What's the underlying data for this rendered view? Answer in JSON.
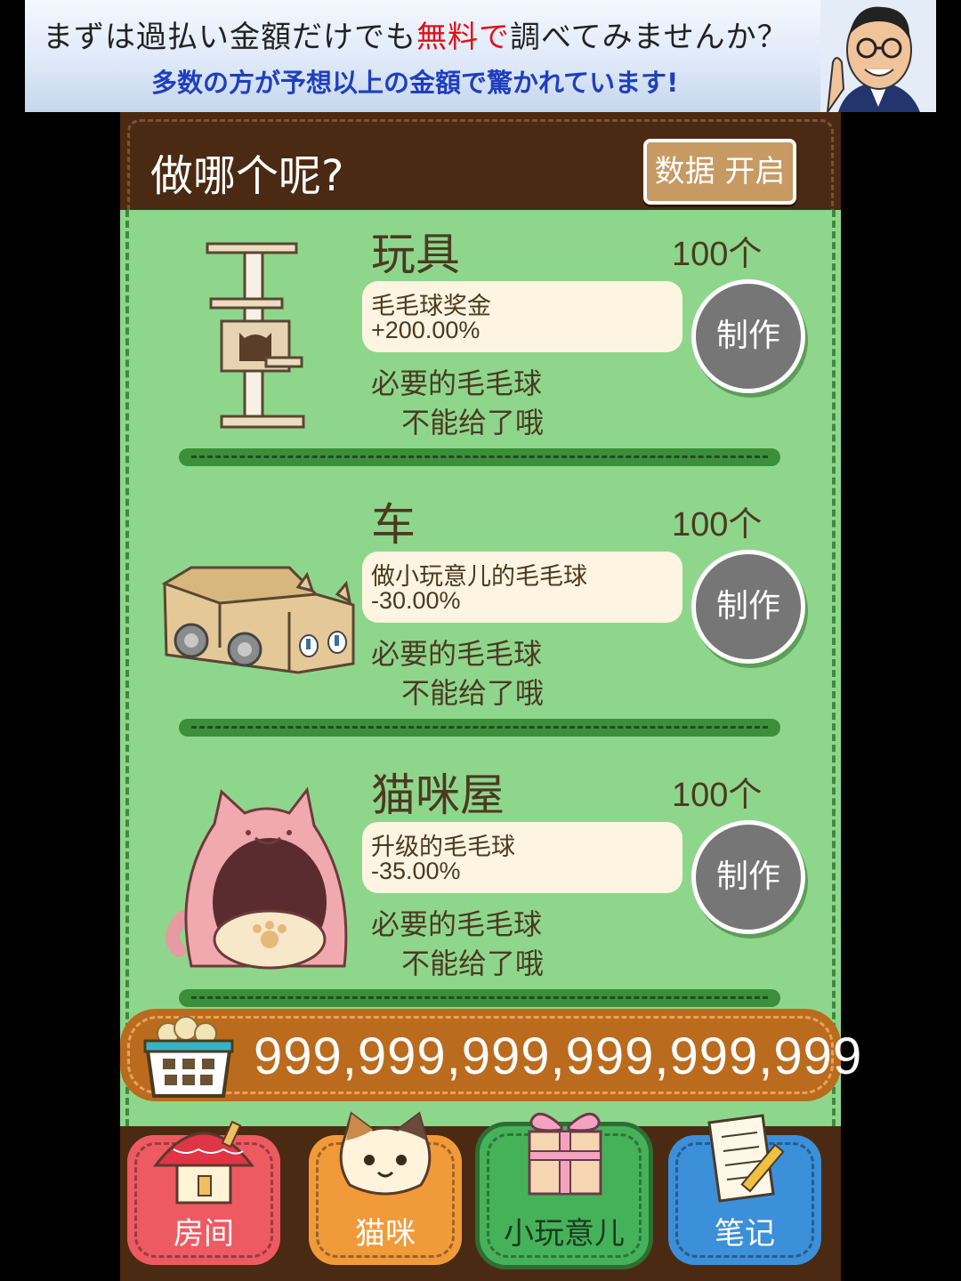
{
  "ad": {
    "line1_pre": "まずは過払い金額だけでも",
    "line1_highlight": "無料で",
    "line1_post": "調べてみませんか？",
    "line2": "多数の方が予想以上の金額で驚かれています!"
  },
  "header": {
    "title": "做哪个呢?",
    "data_button": "数据 开启"
  },
  "items": [
    {
      "name": "玩具",
      "count": "100个",
      "effect_name": "毛毛球奖金",
      "effect_value": "+200.00%",
      "requirement_label": "必要的毛毛球",
      "requirement_value": "不能给了哦",
      "button": "制作",
      "icon": "cat-tower-icon"
    },
    {
      "name": "车",
      "count": "100个",
      "effect_name": "做小玩意儿的毛毛球",
      "effect_value": "-30.00%",
      "requirement_label": "必要的毛毛球",
      "requirement_value": "不能给了哦",
      "button": "制作",
      "icon": "cardboard-car-icon"
    },
    {
      "name": "猫咪屋",
      "count": "100个",
      "effect_name": "升级的毛毛球",
      "effect_value": "-35.00%",
      "requirement_label": "必要的毛毛球",
      "requirement_value": "不能给了哦",
      "button": "制作",
      "icon": "cat-house-icon"
    }
  ],
  "counter": {
    "value": "999,999,999,999,999,999",
    "icon": "basket-icon"
  },
  "nav": {
    "room": "房间",
    "cat": "猫咪",
    "toy": "小玩意儿",
    "note": "笔记"
  },
  "colors": {
    "list_bg": "#8fd68d",
    "frame_brown": "#4a2a12",
    "counter_orange": "#bb6b1e",
    "button_gray": "#767676"
  }
}
